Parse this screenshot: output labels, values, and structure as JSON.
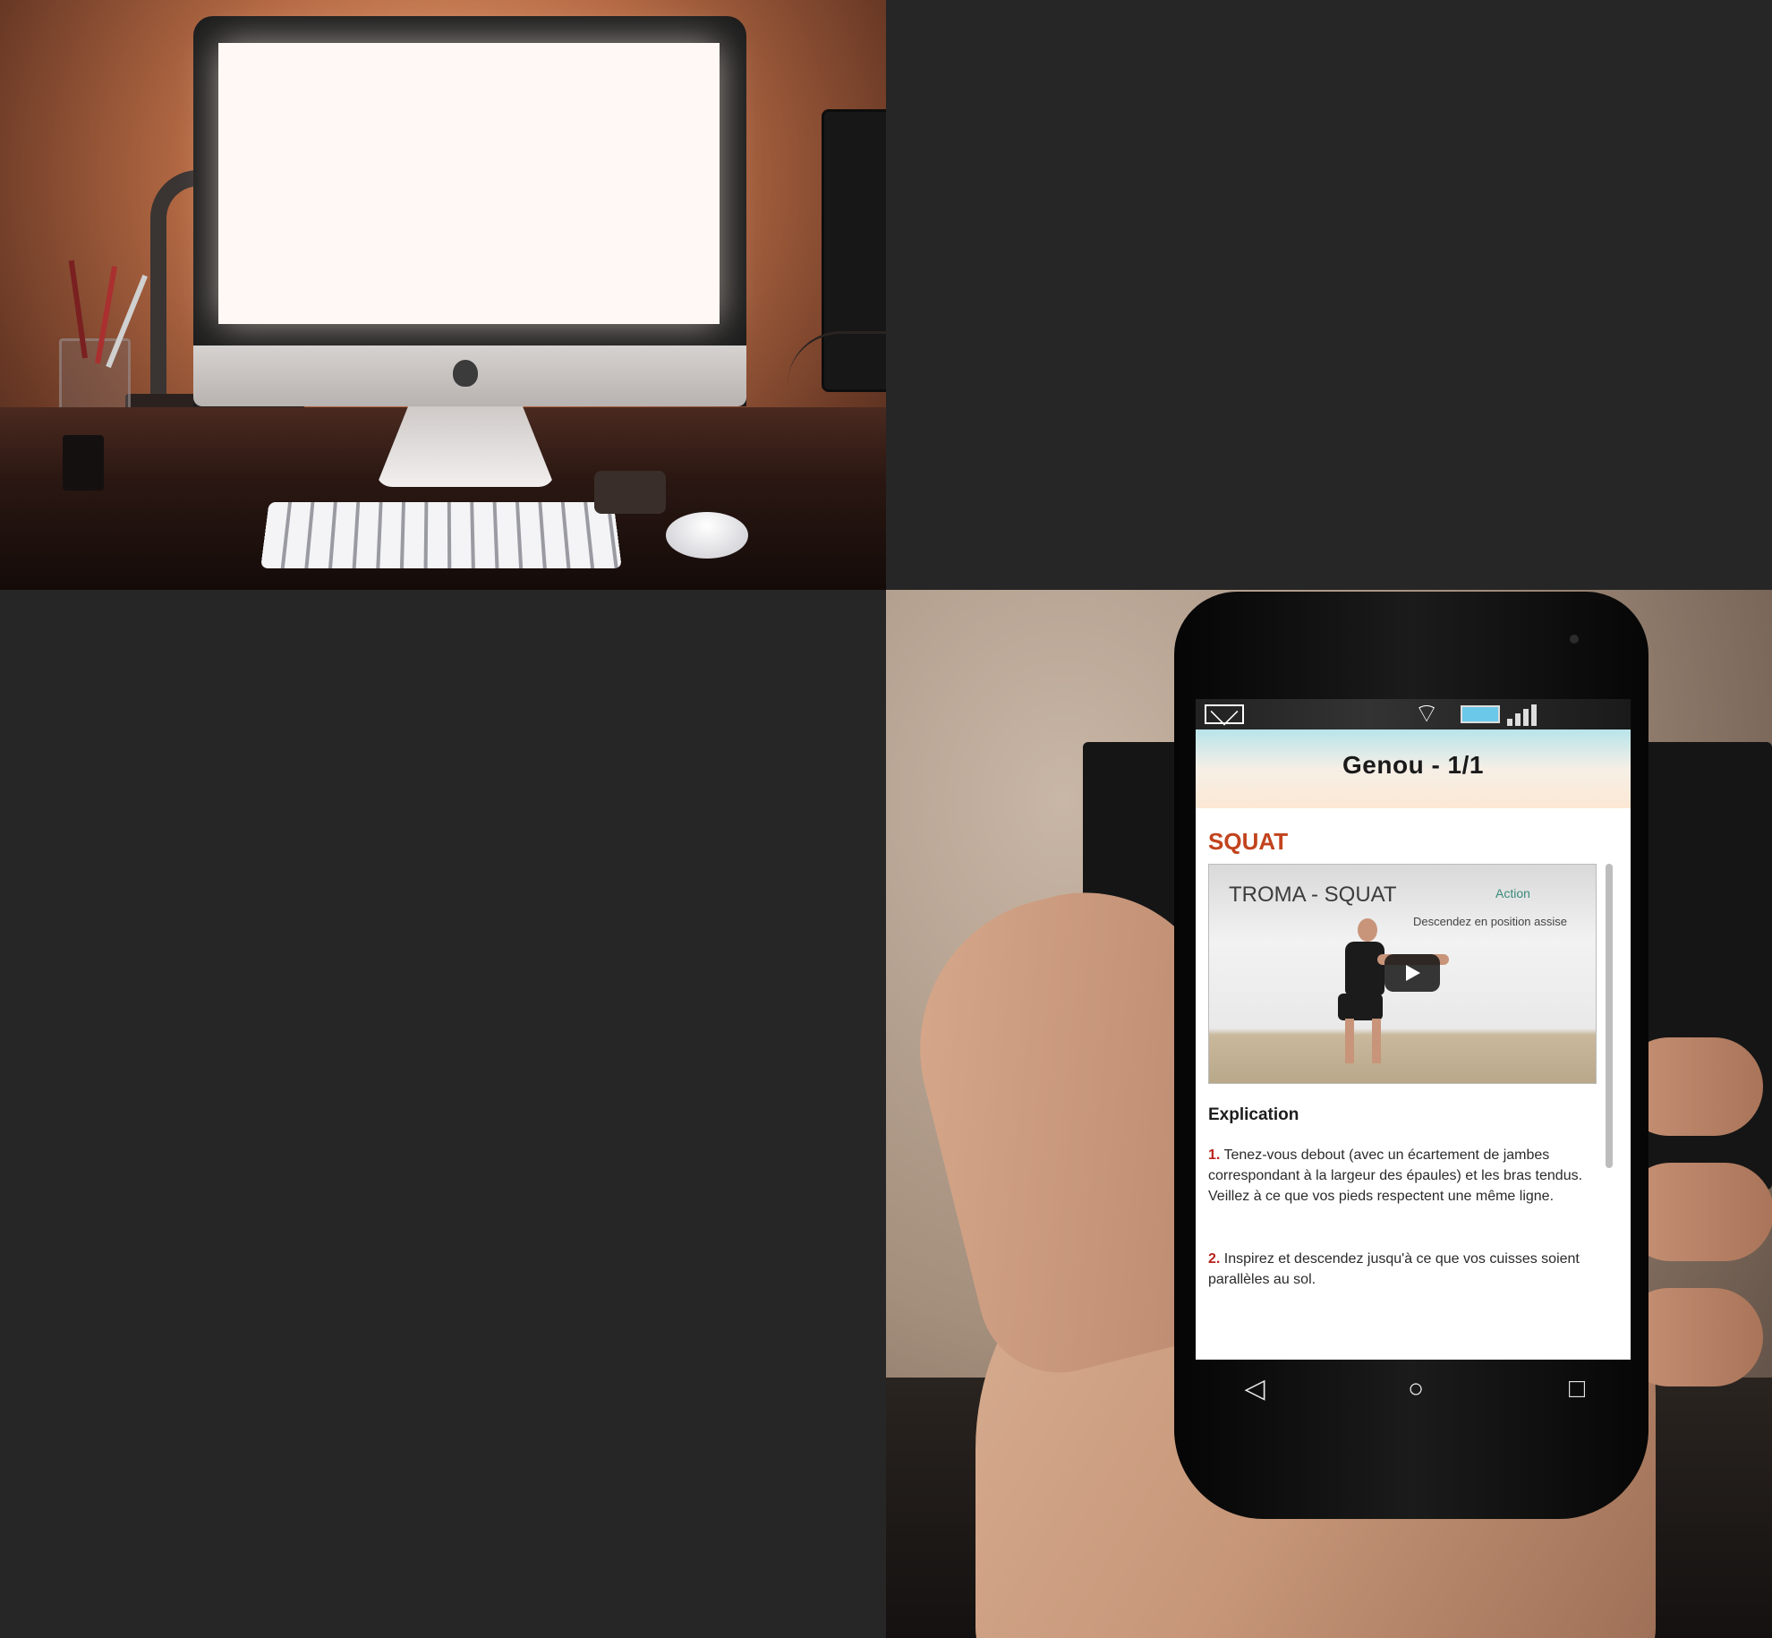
{
  "app": {
    "header_title": "Genou  -  1/1",
    "exercise_name": "SQUAT",
    "video": {
      "title": "TROMA - SQUAT",
      "action_label": "Action",
      "subtitle": "Descendez en position assise"
    },
    "section_title": "Explication",
    "steps": [
      {
        "number": "1.",
        "text": "Tenez-vous debout (avec un écartement de jambes correspondant à la largeur des épaules) et les bras tendus. Veillez à ce que vos pieds respectent une même ligne."
      },
      {
        "number": "2.",
        "text": "Inspirez et descendez jusqu'à ce que vos cuisses soient parallèles au sol."
      }
    ]
  },
  "icons": {
    "status_left": "mail-icon",
    "status_right": [
      "wifi-icon",
      "battery-icon",
      "signal-icon"
    ],
    "nav": [
      "back-icon",
      "home-icon",
      "recents-icon"
    ]
  },
  "colors": {
    "background": "#262626",
    "exercise_name": "#c2431d",
    "step_number": "#b8241c"
  }
}
